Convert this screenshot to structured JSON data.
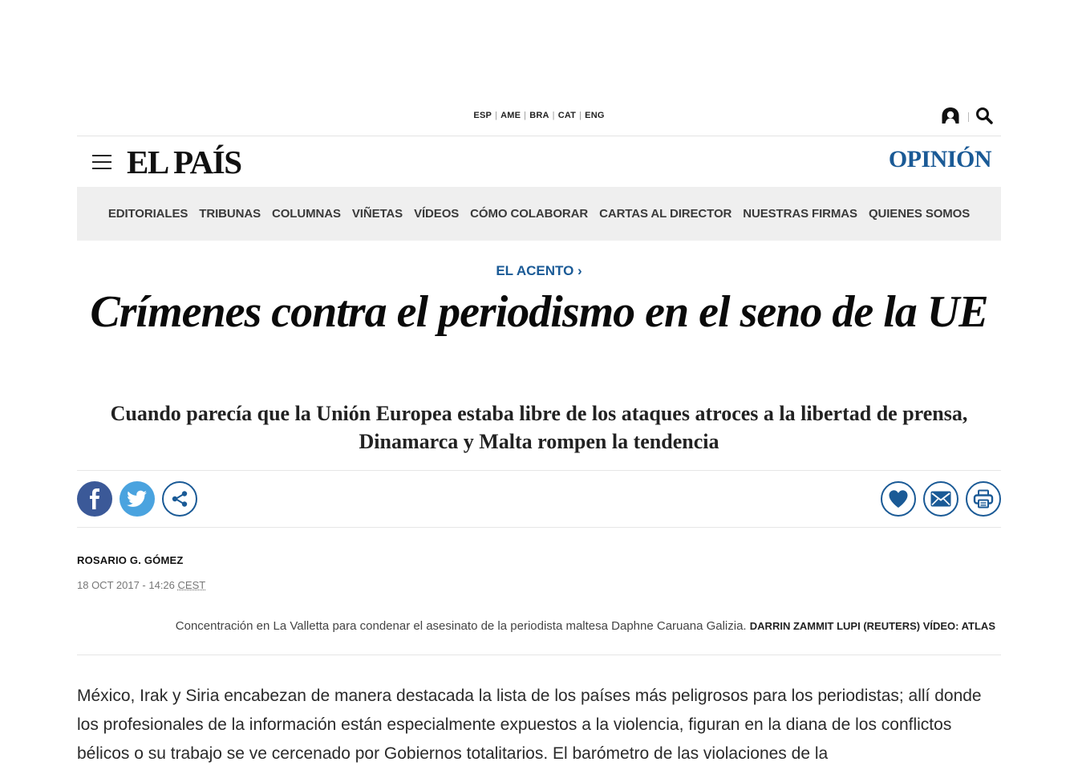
{
  "editions": [
    "ESP",
    "AME",
    "BRA",
    "CAT",
    "ENG"
  ],
  "icons": {
    "user": "user-icon",
    "search": "search-icon",
    "menu": "hamburger-menu-icon"
  },
  "brand": {
    "logo": "EL PAÍS",
    "section": "OPINIÓN",
    "accent": "#1a5a96"
  },
  "nav": {
    "items": [
      "EDITORIALES",
      "TRIBUNAS",
      "COLUMNAS",
      "VIÑETAS",
      "VÍDEOS",
      "CÓMO COLABORAR",
      "CARTAS AL DIRECTOR",
      "NUESTRAS FIRMAS",
      "QUIENES SOMOS"
    ]
  },
  "article": {
    "kicker": "EL ACENTO ›",
    "headline": "Crímenes contra el periodismo en el seno de la UE",
    "subtitle": "Cuando parecía que la Unión Europea estaba libre de los ataques atroces a la libertad de prensa, Dinamarca y Malta rompen la tendencia",
    "author": "ROSARIO G. GÓMEZ",
    "date": "18 OCT 2017 - 14:26",
    "timezone": "CEST",
    "caption": "Concentración en La Valletta para condenar el asesinato de la periodista maltesa Daphne Caruana Galizia.",
    "credit": "DARRIN ZAMMIT LUPI (REUTERS) VÍDEO: ATLAS",
    "body": "México, Irak y Siria encabezan de manera destacada la lista de los países más peligrosos para los periodistas; allí donde los profesionales de la información están especialmente expuestos a la violencia, figuran en la diana de los conflictos bélicos o su trabajo se ve cercenado por Gobiernos totalitarios. El barómetro de las violaciones de la"
  },
  "share": {
    "left": [
      "facebook-icon",
      "twitter-icon",
      "share-icon"
    ],
    "right": [
      "heart-icon",
      "mail-icon",
      "print-icon"
    ]
  }
}
